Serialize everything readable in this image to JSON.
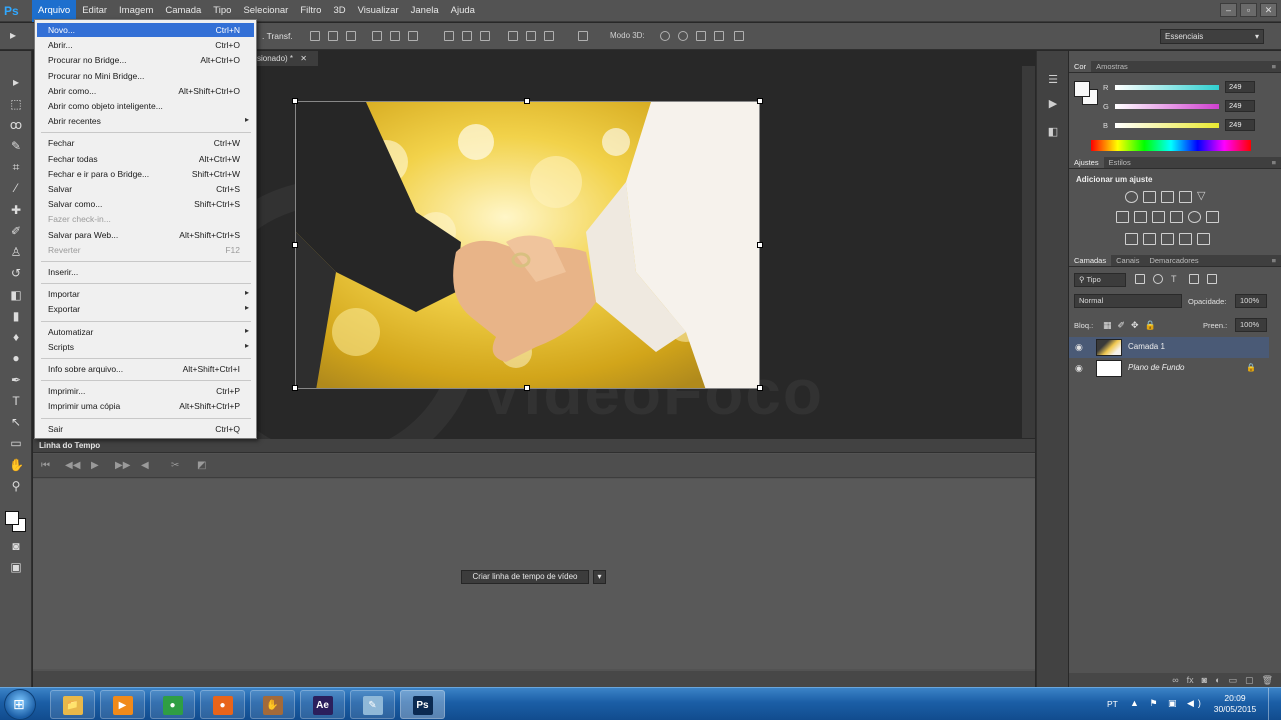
{
  "app": {
    "logo": "Ps"
  },
  "menu": {
    "items": [
      "Arquivo",
      "Editar",
      "Imagem",
      "Camada",
      "Tipo",
      "Selecionar",
      "Filtro",
      "3D",
      "Visualizar",
      "Janela",
      "Ajuda"
    ],
    "active": "Arquivo"
  },
  "window_controls": {
    "minimize": "–",
    "maximize": "▫",
    "close": "✕"
  },
  "options_bar": {
    "transform_label": ". Transf.",
    "mode3d_label": "Modo 3D:",
    "workspace": "Essenciais"
  },
  "document": {
    "tab_title": "sionado) *"
  },
  "file_menu": [
    {
      "label": "Novo...",
      "shortcut": "Ctrl+N",
      "highlight": true
    },
    {
      "label": "Abrir...",
      "shortcut": "Ctrl+O"
    },
    {
      "label": "Procurar no Bridge...",
      "shortcut": "Alt+Ctrl+O"
    },
    {
      "label": "Procurar no Mini Bridge...",
      "shortcut": ""
    },
    {
      "label": "Abrir como...",
      "shortcut": "Alt+Shift+Ctrl+O"
    },
    {
      "label": "Abrir como objeto inteligente...",
      "shortcut": ""
    },
    {
      "label": "Abrir recentes",
      "shortcut": "",
      "submenu": true
    },
    {
      "separator": true
    },
    {
      "label": "Fechar",
      "shortcut": "Ctrl+W"
    },
    {
      "label": "Fechar todas",
      "shortcut": "Alt+Ctrl+W"
    },
    {
      "label": "Fechar e ir para o Bridge...",
      "shortcut": "Shift+Ctrl+W"
    },
    {
      "label": "Salvar",
      "shortcut": "Ctrl+S"
    },
    {
      "label": "Salvar como...",
      "shortcut": "Shift+Ctrl+S"
    },
    {
      "label": "Fazer check-in...",
      "shortcut": "",
      "disabled": true
    },
    {
      "label": "Salvar para Web...",
      "shortcut": "Alt+Shift+Ctrl+S"
    },
    {
      "label": "Reverter",
      "shortcut": "F12",
      "disabled": true
    },
    {
      "separator": true
    },
    {
      "label": "Inserir...",
      "shortcut": ""
    },
    {
      "separator": true
    },
    {
      "label": "Importar",
      "shortcut": "",
      "submenu": true
    },
    {
      "label": "Exportar",
      "shortcut": "",
      "submenu": true
    },
    {
      "separator": true
    },
    {
      "label": "Automatizar",
      "shortcut": "",
      "submenu": true
    },
    {
      "label": "Scripts",
      "shortcut": "",
      "submenu": true
    },
    {
      "separator": true
    },
    {
      "label": "Info sobre arquivo...",
      "shortcut": "Alt+Shift+Ctrl+I"
    },
    {
      "separator": true
    },
    {
      "label": "Imprimir...",
      "shortcut": "Ctrl+P"
    },
    {
      "label": "Imprimir uma cópia",
      "shortcut": "Alt+Shift+Ctrl+P"
    },
    {
      "separator": true
    },
    {
      "label": "Sair",
      "shortcut": "Ctrl+Q"
    }
  ],
  "timeline": {
    "title": "Linha do Tempo",
    "create_button": "Criar linha de tempo de vídeo",
    "dropdown_arrow": "▾"
  },
  "color_panel": {
    "tabs": [
      "Cor",
      "Amostras"
    ],
    "channels": [
      {
        "label": "R",
        "value": "249",
        "track_color": "#2fd0d0"
      },
      {
        "label": "G",
        "value": "249",
        "track_color": "#d040d0"
      },
      {
        "label": "B",
        "value": "249",
        "track_color": "#e8e830"
      }
    ]
  },
  "adjustments_panel": {
    "tabs": [
      "Ajustes",
      "Estilos"
    ],
    "title": "Adicionar um ajuste"
  },
  "layers_panel": {
    "tabs": [
      "Camadas",
      "Canais",
      "Demarcadores"
    ],
    "filter": "Tipo",
    "blend_mode": "Normal",
    "opacity_label": "Opacidade:",
    "opacity_value": "100%",
    "lock_label": "Bloq.:",
    "fill_label": "Preen.:",
    "fill_value": "100%",
    "layers": [
      {
        "name": "Camada 1",
        "selected": true
      },
      {
        "name": "Plano de Fundo",
        "locked": true
      }
    ]
  },
  "watermark": {
    "text": "VideoFoco"
  },
  "taskbar": {
    "apps": [
      {
        "name": "explorer",
        "glyph": "📁",
        "color": "#e8b84a"
      },
      {
        "name": "media",
        "glyph": "▶",
        "color": "#f08a1a"
      },
      {
        "name": "chrome",
        "glyph": "●",
        "color": "#2f9e44"
      },
      {
        "name": "firefox",
        "glyph": "●",
        "color": "#e8641a"
      },
      {
        "name": "gimp",
        "glyph": "✋",
        "color": "#a36a3a"
      },
      {
        "name": "after-effects",
        "glyph": "Ae",
        "color": "#2b1f5c"
      },
      {
        "name": "notes",
        "glyph": "✎",
        "color": "#8fb8d8"
      },
      {
        "name": "photoshop",
        "glyph": "Ps",
        "color": "#0b2a52",
        "active": true
      }
    ],
    "language": "PT",
    "time": "20:09",
    "date": "30/05/2015"
  }
}
